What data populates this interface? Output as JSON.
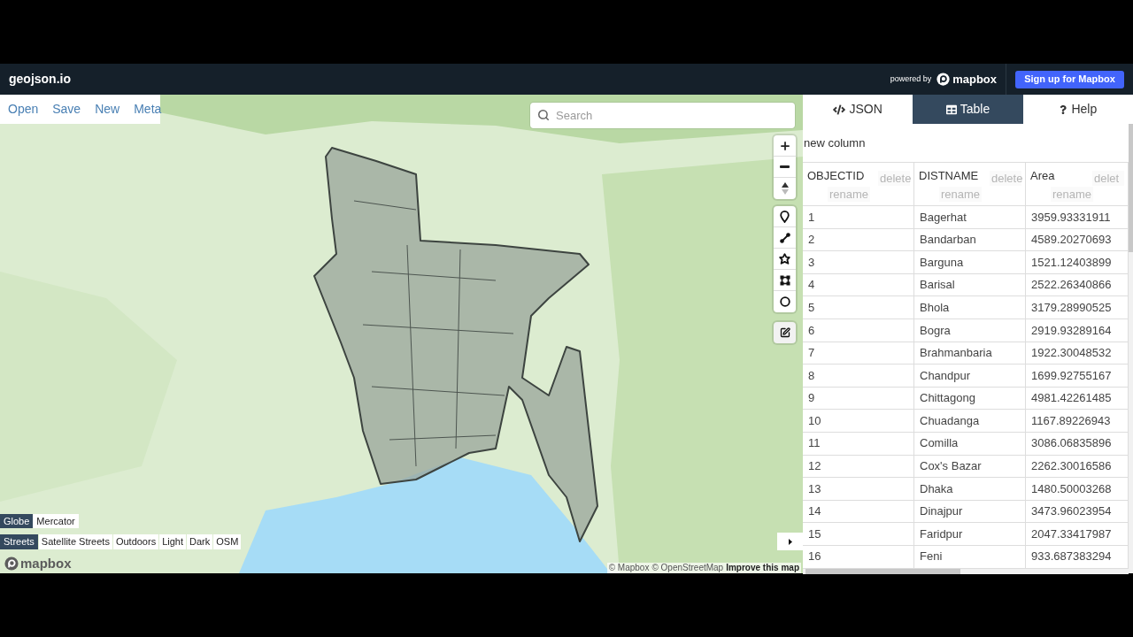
{
  "header": {
    "logo": "geojson.io",
    "powered_by": "powered by",
    "brand": "mapbox",
    "signup_button": "Sign up for Mapbox"
  },
  "map": {
    "menu": [
      "Open",
      "Save",
      "New",
      "Meta"
    ],
    "search": {
      "placeholder": "Search"
    },
    "projections": [
      {
        "label": "Globe",
        "selected": true
      },
      {
        "label": "Mercator",
        "selected": false
      }
    ],
    "styles": [
      {
        "label": "Streets",
        "selected": true
      },
      {
        "label": "Satellite Streets",
        "selected": false
      },
      {
        "label": "Outdoors",
        "selected": false
      },
      {
        "label": "Light",
        "selected": false
      },
      {
        "label": "Dark",
        "selected": false
      },
      {
        "label": "OSM",
        "selected": false
      }
    ],
    "logo": "mapbox",
    "attribution": [
      "© Mapbox",
      "© OpenStreetMap"
    ],
    "improve_link": "Improve this map"
  },
  "panel": {
    "tabs": [
      {
        "kind": "json",
        "label": "JSON",
        "selected": false
      },
      {
        "kind": "table",
        "label": "Table",
        "selected": true
      },
      {
        "kind": "help",
        "label": "Help",
        "selected": false
      }
    ],
    "new_column": "new column",
    "table": {
      "columns": [
        {
          "name": "OBJECTID",
          "delete": "delete",
          "rename": "rename"
        },
        {
          "name": "DISTNAME",
          "delete": "delete",
          "rename": "rename"
        },
        {
          "name": "Area",
          "delete": "delet",
          "rename": "rename"
        }
      ],
      "rows": [
        [
          "1",
          "Bagerhat",
          "3959.93331911"
        ],
        [
          "2",
          "Bandarban",
          "4589.20270693"
        ],
        [
          "3",
          "Barguna",
          "1521.12403899"
        ],
        [
          "4",
          "Barisal",
          "2522.26340866"
        ],
        [
          "5",
          "Bhola",
          "3179.28990525"
        ],
        [
          "6",
          "Bogra",
          "2919.93289164"
        ],
        [
          "7",
          "Brahmanbaria",
          "1922.30048532"
        ],
        [
          "8",
          "Chandpur",
          "1699.92755167"
        ],
        [
          "9",
          "Chittagong",
          "4981.42261485"
        ],
        [
          "10",
          "Chuadanga",
          "1167.89226943"
        ],
        [
          "11",
          "Comilla",
          "3086.06835896"
        ],
        [
          "12",
          "Cox's Bazar",
          "2262.30016586"
        ],
        [
          "13",
          "Dhaka",
          "1480.50003268"
        ],
        [
          "14",
          "Dinajpur",
          "3473.96023954"
        ],
        [
          "15",
          "Faridpur",
          "2047.33417987"
        ],
        [
          "16",
          "Feni",
          "933.687383294"
        ]
      ]
    }
  }
}
